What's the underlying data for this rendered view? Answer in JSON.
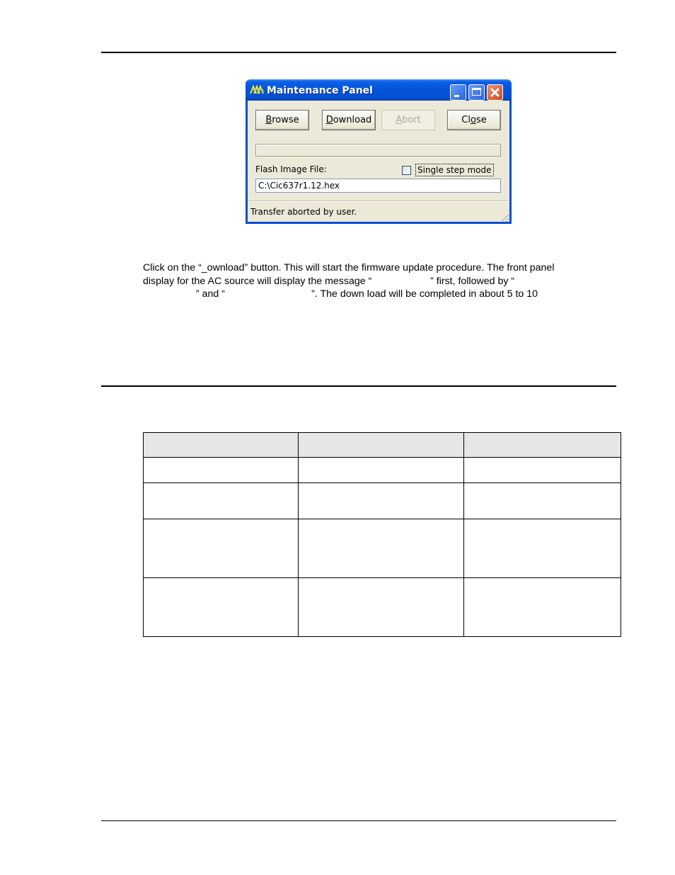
{
  "window": {
    "title": "Maintenance Panel",
    "buttons": {
      "browse": {
        "label_pre": "",
        "mnemonic": "B",
        "label_post": "rowse",
        "enabled": true
      },
      "download": {
        "label_pre": "",
        "mnemonic": "D",
        "label_post": "ownload",
        "enabled": true
      },
      "abort": {
        "label_pre": "",
        "mnemonic": "A",
        "label_post": "bort",
        "enabled": false
      },
      "close": {
        "label_pre": "Cl",
        "mnemonic": "o",
        "label_post": "se",
        "enabled": true
      }
    },
    "progress": 0,
    "flash_image_label": "Flash Image File:",
    "single_step": {
      "label": "Single step mode",
      "checked": false
    },
    "flash_image_value": "C:\\Cic637r1.12.hex",
    "status": "Transfer aborted by user.",
    "colors": {
      "titlebar": "#0453d9",
      "client": "#ece9d8",
      "close_button": "#d34a1c"
    }
  },
  "body": {
    "line1": "Click on the “_ownload” button. This will start the firmware update procedure. The front panel",
    "line2": "display for the AC source will display the message “                     ” first, followed by “",
    "line3": "                   ” and “                               ”. The down load will be completed in about 5 to 10"
  },
  "table": {
    "headers": [
      "",
      "",
      ""
    ],
    "rows": [
      [
        "",
        "",
        ""
      ],
      [
        "",
        "",
        ""
      ],
      [
        "",
        "",
        ""
      ],
      [
        "",
        "",
        ""
      ]
    ],
    "header_bg": "#e6e6e6"
  }
}
